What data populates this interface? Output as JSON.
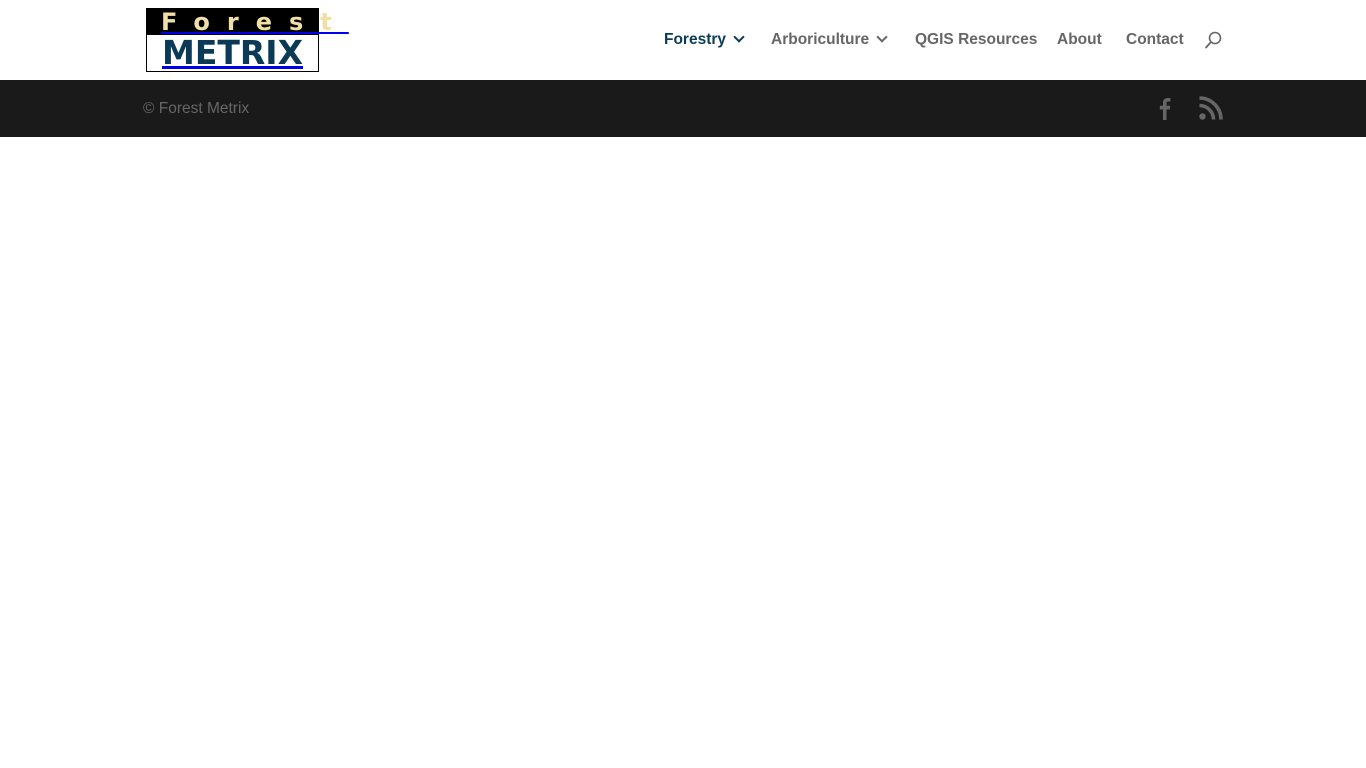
{
  "header": {
    "logo": {
      "line1": "Forest",
      "line2": "METRIX",
      "alt": "Forest Metrix"
    },
    "nav": [
      {
        "label": "Forestry",
        "has_dropdown": true,
        "active": true
      },
      {
        "label": "Arboriculture",
        "has_dropdown": true,
        "active": false
      },
      {
        "label": "QGIS Resources",
        "has_dropdown": false,
        "active": false
      },
      {
        "label": "About",
        "has_dropdown": false,
        "active": false
      },
      {
        "label": "Contact",
        "has_dropdown": false,
        "active": false
      }
    ],
    "search_icon": "search-icon"
  },
  "footer": {
    "copyright": "© Forest Metrix",
    "social": [
      "facebook-icon",
      "rss-icon"
    ]
  },
  "colors": {
    "accent": "#0c3b57",
    "nav_text": "#666666",
    "footer_bg": "#1a1a1a",
    "footer_text": "#666666",
    "logo_gold": "#f1dfa6"
  }
}
